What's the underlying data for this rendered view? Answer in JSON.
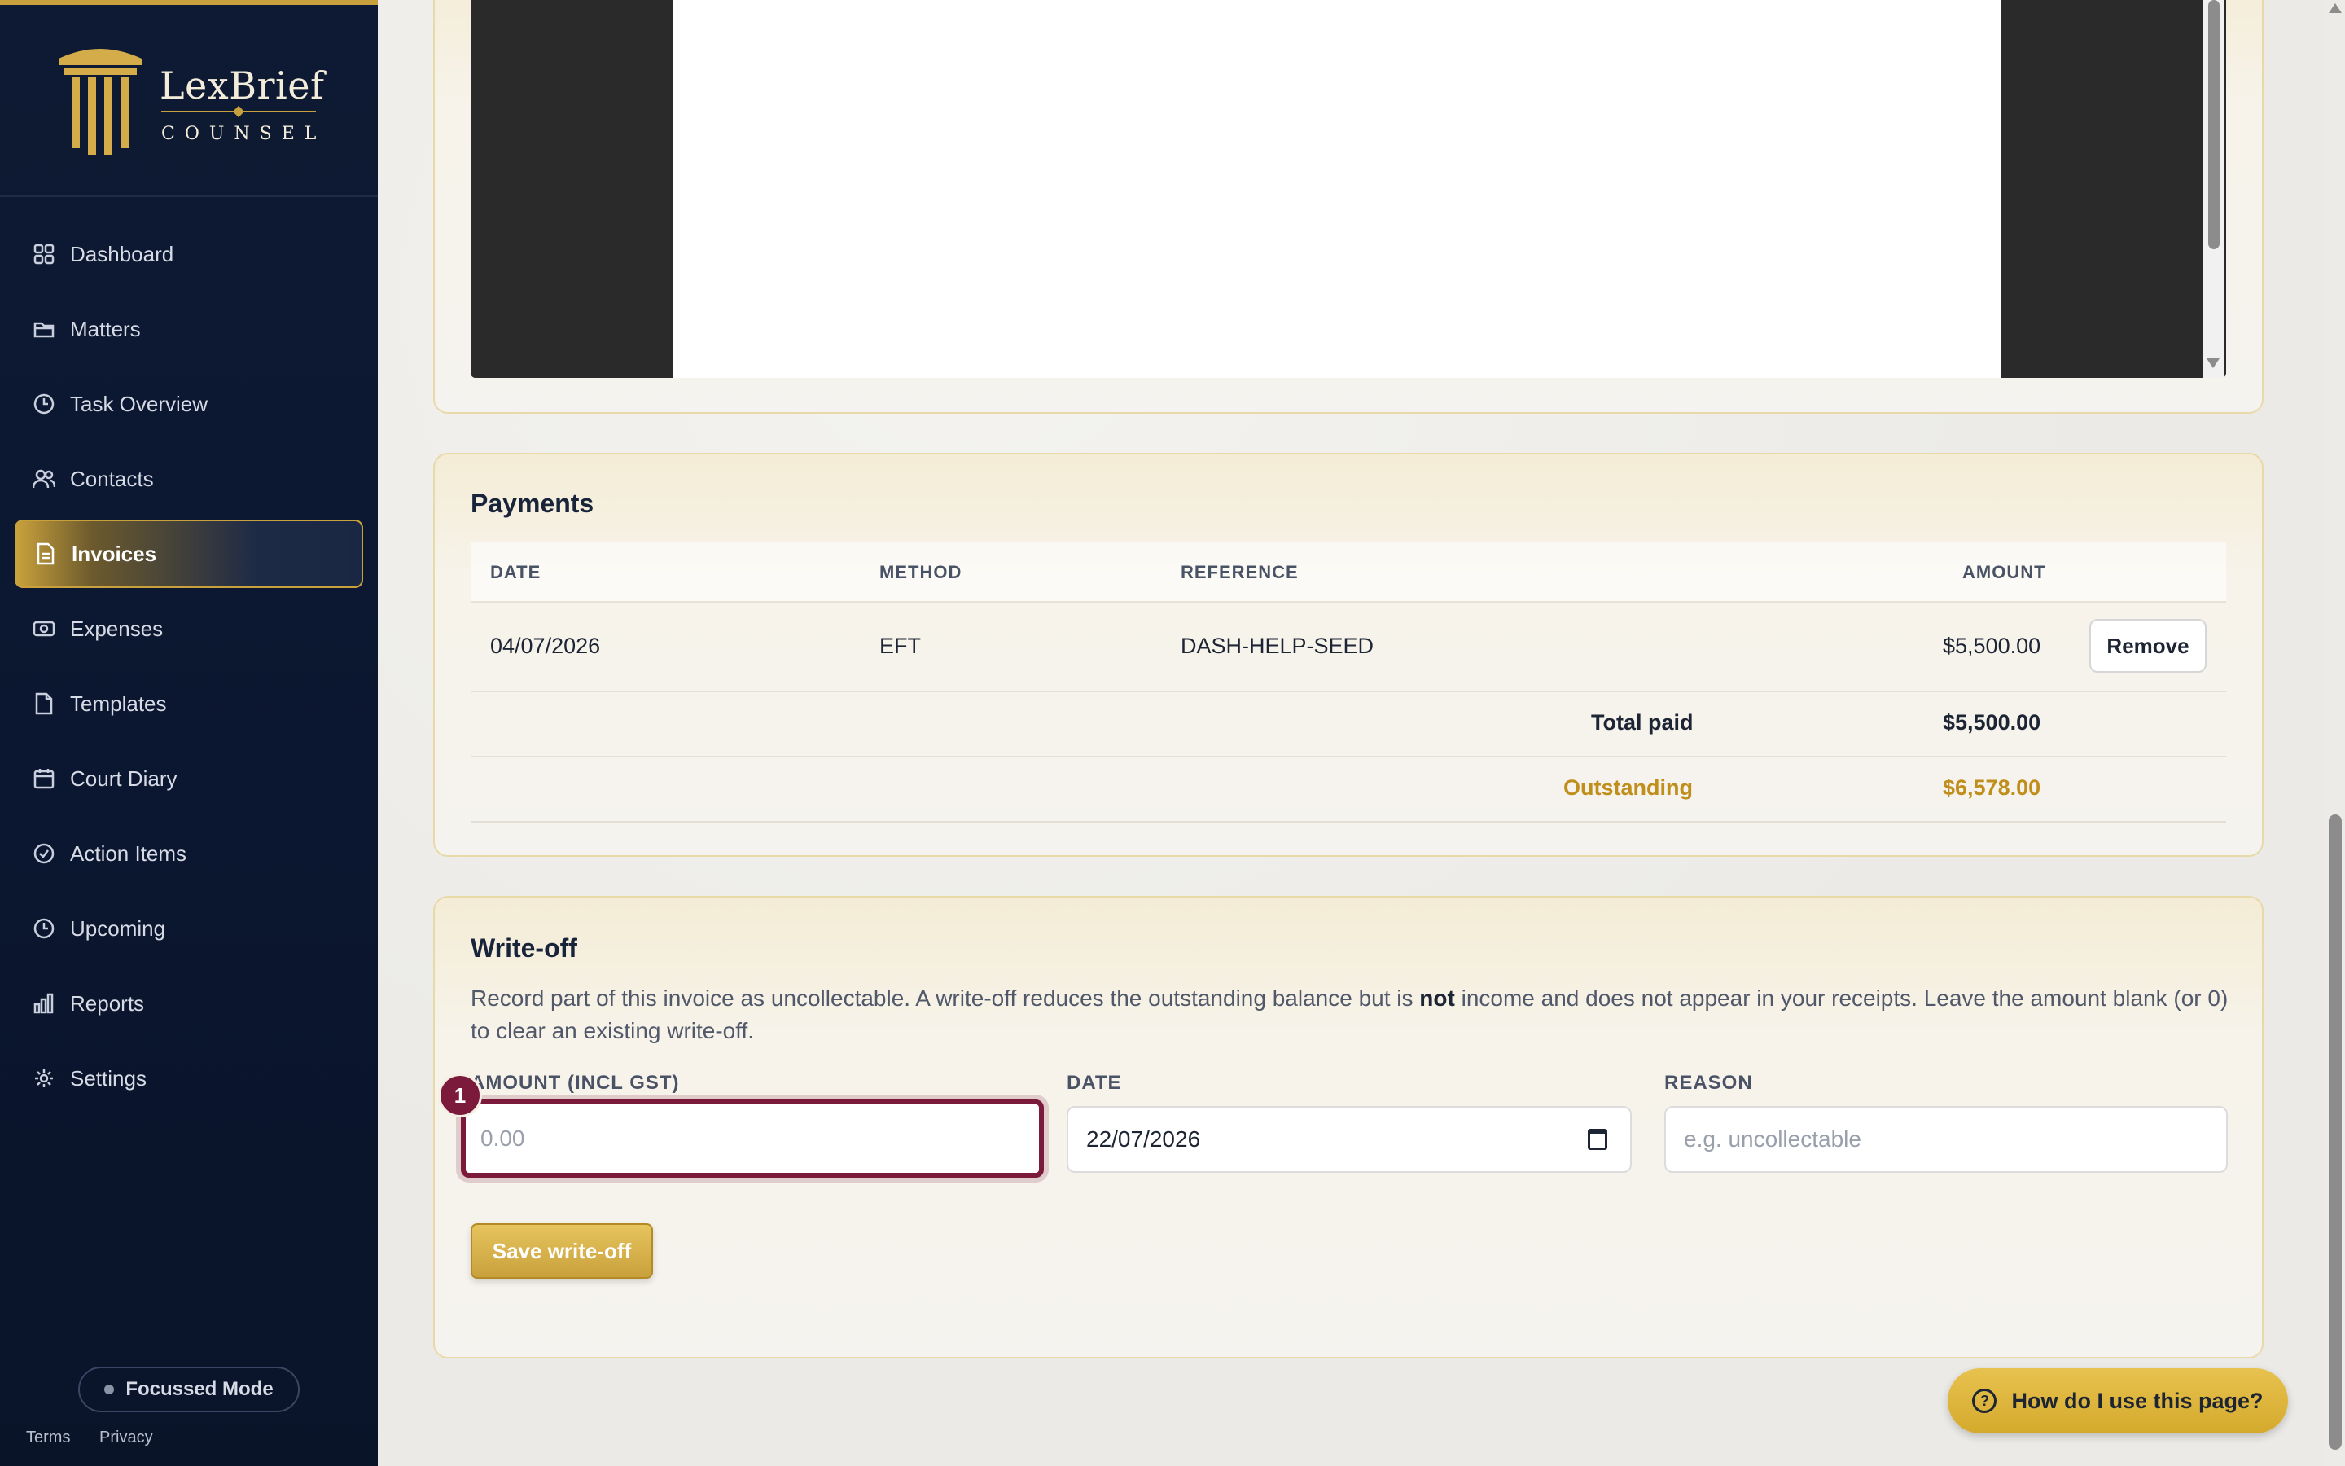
{
  "brand": {
    "name": "LexBrief",
    "sub": "COUNSEL"
  },
  "sidebar": {
    "items": [
      {
        "label": "Dashboard",
        "icon": "grid-icon"
      },
      {
        "label": "Matters",
        "icon": "folder-icon"
      },
      {
        "label": "Task Overview",
        "icon": "clock-icon"
      },
      {
        "label": "Contacts",
        "icon": "users-icon"
      },
      {
        "label": "Invoices",
        "icon": "document-icon",
        "active": true
      },
      {
        "label": "Expenses",
        "icon": "wallet-icon"
      },
      {
        "label": "Templates",
        "icon": "file-icon"
      },
      {
        "label": "Court Diary",
        "icon": "calendar-icon"
      },
      {
        "label": "Action Items",
        "icon": "check-circle-icon"
      },
      {
        "label": "Upcoming",
        "icon": "clock-icon"
      },
      {
        "label": "Reports",
        "icon": "bar-chart-icon"
      },
      {
        "label": "Settings",
        "icon": "gear-icon"
      }
    ],
    "focus_mode": "Focussed Mode",
    "footer": {
      "terms": "Terms",
      "privacy": "Privacy"
    }
  },
  "payments": {
    "title": "Payments",
    "columns": {
      "date": "DATE",
      "method": "METHOD",
      "reference": "REFERENCE",
      "amount": "AMOUNT"
    },
    "rows": [
      {
        "date": "04/07/2026",
        "method": "EFT",
        "reference": "DASH-HELP-SEED",
        "amount": "$5,500.00",
        "action": "Remove"
      }
    ],
    "total_paid_label": "Total paid",
    "total_paid": "$5,500.00",
    "outstanding_label": "Outstanding",
    "outstanding": "$6,578.00"
  },
  "writeoff": {
    "title": "Write-off",
    "desc_before": "Record part of this invoice as uncollectable. A write-off reduces the outstanding balance but is ",
    "desc_bold": "not",
    "desc_after": " income and does not appear in your receipts. Leave the amount blank (or 0) to clear an existing write-off.",
    "amount_label": "AMOUNT (INCL GST)",
    "amount_placeholder": "0.00",
    "date_label": "DATE",
    "date_value": "22/07/2026",
    "reason_label": "REASON",
    "reason_placeholder": "e.g. uncollectable",
    "save_label": "Save write-off",
    "badge": "1"
  },
  "help": {
    "label": "How do I use this page?"
  },
  "colors": {
    "accent_gold": "#c9a13c",
    "sidebar_bg": "#0e1a33",
    "focus_ring": "#7c1a3c",
    "outstanding": "#c08e1a"
  }
}
